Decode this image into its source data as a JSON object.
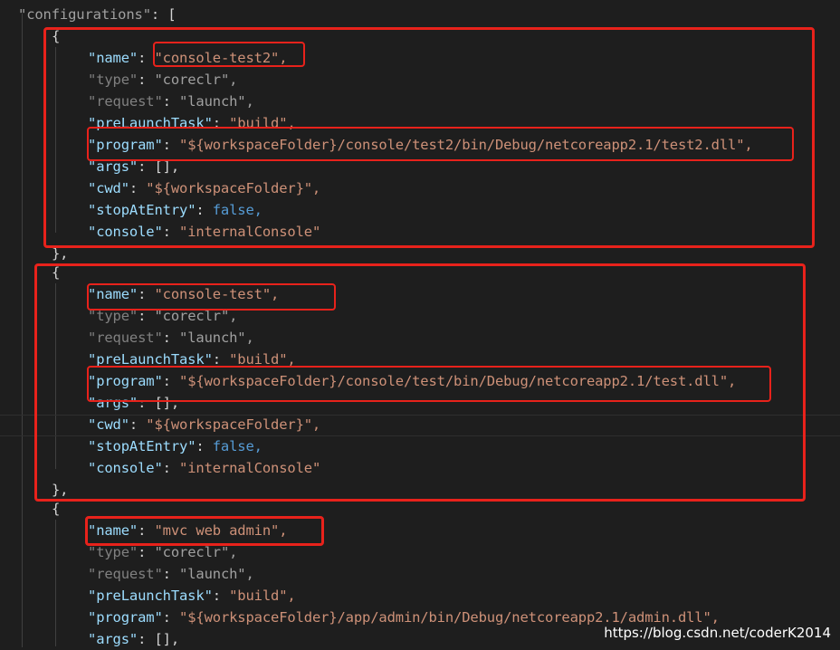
{
  "header": {
    "key": "configurations",
    "suffix": ": ["
  },
  "configs": [
    {
      "open": "{",
      "close": "},",
      "props": [
        {
          "key": "name",
          "value": "\"console-test2\",",
          "dim": false
        },
        {
          "key": "type",
          "value": "\"coreclr\",",
          "dim": true
        },
        {
          "key": "request",
          "value": "\"launch\",",
          "dim": true
        },
        {
          "key": "preLaunchTask",
          "value": "\"build\",",
          "dim": false
        },
        {
          "key": "program",
          "value": "\"${workspaceFolder}/console/test2/bin/Debug/netcoreapp2.1/test2.dll\",",
          "dim": false
        },
        {
          "key": "args",
          "value": "[],",
          "dim": false
        },
        {
          "key": "cwd",
          "value": "\"${workspaceFolder}\",",
          "dim": false
        },
        {
          "key": "stopAtEntry",
          "value": "false,",
          "dim": false
        },
        {
          "key": "console",
          "value": "\"internalConsole\"",
          "dim": false
        }
      ]
    },
    {
      "open": "{",
      "close": "},",
      "props": [
        {
          "key": "name",
          "value": "\"console-test\",",
          "dim": false
        },
        {
          "key": "type",
          "value": "\"coreclr\",",
          "dim": true
        },
        {
          "key": "request",
          "value": "\"launch\",",
          "dim": true
        },
        {
          "key": "preLaunchTask",
          "value": "\"build\",",
          "dim": false
        },
        {
          "key": "program",
          "value": "\"${workspaceFolder}/console/test/bin/Debug/netcoreapp2.1/test.dll\",",
          "dim": false
        },
        {
          "key": "args",
          "value": "[],",
          "dim": false
        },
        {
          "key": "cwd",
          "value": "\"${workspaceFolder}\",",
          "dim": false
        },
        {
          "key": "stopAtEntry",
          "value": "false,",
          "dim": false
        },
        {
          "key": "console",
          "value": "\"internalConsole\"",
          "dim": false
        }
      ]
    },
    {
      "open": "{",
      "close": "",
      "props": [
        {
          "key": "name",
          "value": "\"mvc web admin\",",
          "dim": false
        },
        {
          "key": "type",
          "value": "\"coreclr\",",
          "dim": true
        },
        {
          "key": "request",
          "value": "\"launch\",",
          "dim": true
        },
        {
          "key": "preLaunchTask",
          "value": "\"build\",",
          "dim": false
        },
        {
          "key": "program",
          "value": "\"${workspaceFolder}/app/admin/bin/Debug/netcoreapp2.1/admin.dll\",",
          "dim": false
        },
        {
          "key": "args",
          "value": "[],",
          "dim": false
        }
      ]
    }
  ],
  "watermark": "https://blog.csdn.net/coderK2014",
  "colors": {
    "background": "#1e1e1e",
    "key": "#9cdcfe",
    "string": "#ce9178",
    "boolean": "#569cd6",
    "punctuation": "#d4d4d4",
    "annotation": "#e8221b"
  }
}
